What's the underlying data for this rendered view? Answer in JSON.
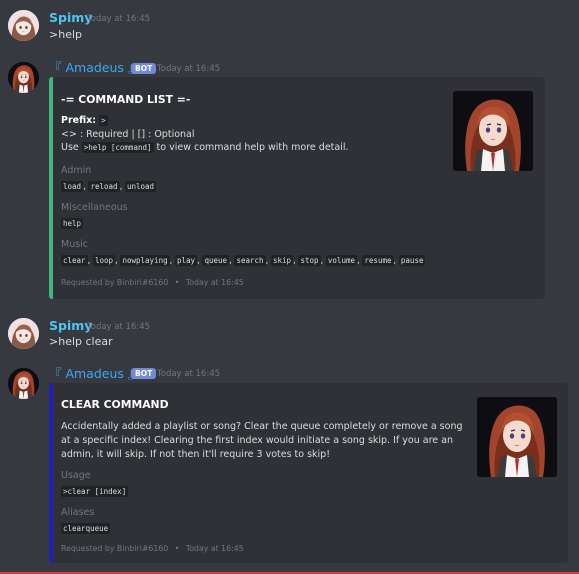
{
  "colors": {
    "background": "#36393f",
    "embed_background": "#2f3136",
    "embed_bar_green": "#43b581",
    "embed_bar_blue": "#1d21b5",
    "username_spimy": "#4ec6f2",
    "username_amadeus": "#3ea7f4",
    "bot_badge": "#7289da"
  },
  "messages": [
    {
      "author": "Spimy",
      "timestamp": "Today at 16:45",
      "text": ">help"
    },
    {
      "author": "『 Amadeus 』",
      "bot_badge": "BOT",
      "timestamp": "Today at 16:45",
      "embed": {
        "title": "-= COMMAND LIST =-",
        "prefix_label": "Prefix:",
        "prefix_value": ">",
        "syntax_line": "<> : Required | [] : Optional",
        "use_prefix": "Use",
        "use_code": ">help [command]",
        "use_suffix": "to view command help with more detail.",
        "fields": [
          {
            "name": "Admin",
            "values": [
              "load",
              "reload",
              "unload"
            ]
          },
          {
            "name": "Miscellaneous",
            "values": [
              "help"
            ]
          },
          {
            "name": "Music",
            "values": [
              "clear",
              "loop",
              "nowplaying",
              "play",
              "queue",
              "search",
              "skip",
              "stop",
              "volume",
              "resume",
              "pause"
            ]
          }
        ],
        "footer_text": "Requested by Binbiri#6160",
        "footer_time": "Today at 16:45"
      }
    },
    {
      "author": "Spimy",
      "timestamp": "Today at 16:45",
      "text": ">help clear"
    },
    {
      "author": "『 Amadeus 』",
      "bot_badge": "BOT",
      "timestamp": "Today at 16:45",
      "embed": {
        "title": "CLEAR COMMAND",
        "description": "Accidentally added a playlist or song? Clear the queue completely or remove a song at a specific index! Clearing the first index would initiate a song skip. If you are an admin, it will skip. If not then it'll require 3 votes to skip!",
        "fields": [
          {
            "name": "Usage",
            "value": ">clear [index]"
          },
          {
            "name": "Aliases",
            "value": "clearqueue"
          }
        ],
        "footer_text": "Requested by Binbiri#6160",
        "footer_time": "Today at 16:45"
      }
    }
  ],
  "footer_separator": "•",
  "comma": ","
}
